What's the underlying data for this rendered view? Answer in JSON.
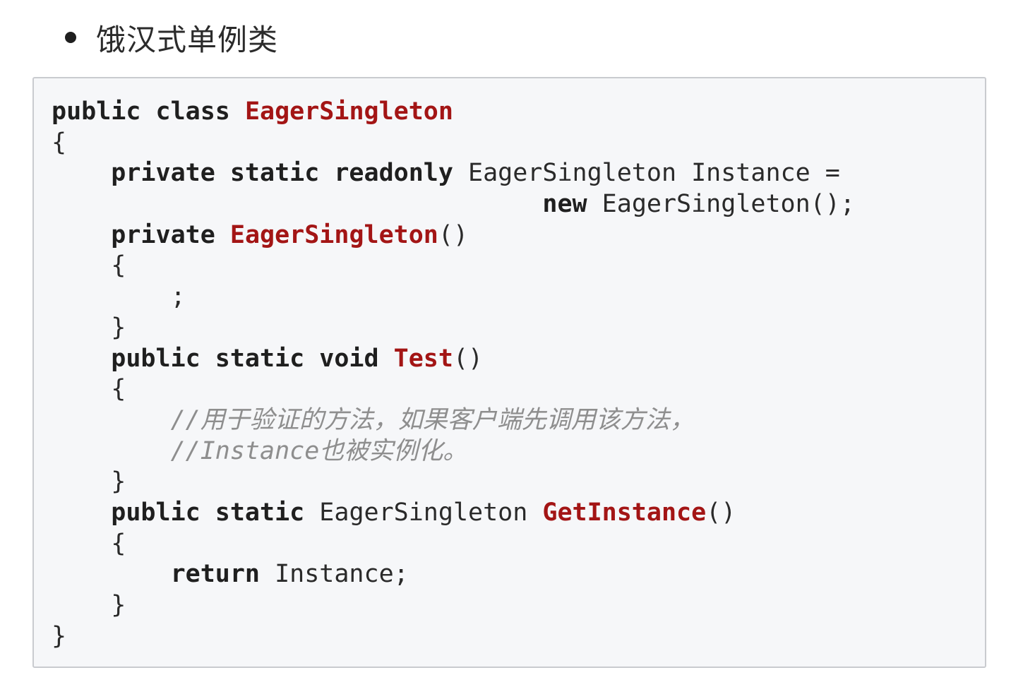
{
  "heading": "饿汉式单例类",
  "code": {
    "lines": [
      [
        {
          "t": "public class ",
          "c": "kw"
        },
        {
          "t": "EagerSingleton",
          "c": "name"
        }
      ],
      [
        {
          "t": "{",
          "c": "txt"
        }
      ],
      [
        {
          "t": "    private static readonly ",
          "c": "kw"
        },
        {
          "t": "EagerSingleton Instance =",
          "c": "txt"
        }
      ],
      [
        {
          "t": "                                 ",
          "c": "txt"
        },
        {
          "t": "new ",
          "c": "kw"
        },
        {
          "t": "EagerSingleton();",
          "c": "txt"
        }
      ],
      [
        {
          "t": "    private ",
          "c": "kw"
        },
        {
          "t": "EagerSingleton",
          "c": "name"
        },
        {
          "t": "()",
          "c": "txt"
        }
      ],
      [
        {
          "t": "    {",
          "c": "txt"
        }
      ],
      [
        {
          "t": "        ;",
          "c": "txt"
        }
      ],
      [
        {
          "t": "    }",
          "c": "txt"
        }
      ],
      [
        {
          "t": "    public static void ",
          "c": "kw"
        },
        {
          "t": "Test",
          "c": "name"
        },
        {
          "t": "()",
          "c": "txt"
        }
      ],
      [
        {
          "t": "    {",
          "c": "txt"
        }
      ],
      [
        {
          "t": "        //用于验证的方法，如果客户端先调用该方法，",
          "c": "cmt"
        }
      ],
      [
        {
          "t": "        //Instance也被实例化。",
          "c": "cmt"
        }
      ],
      [
        {
          "t": "    }",
          "c": "txt"
        }
      ],
      [
        {
          "t": "    public static ",
          "c": "kw"
        },
        {
          "t": "EagerSingleton ",
          "c": "txt"
        },
        {
          "t": "GetInstance",
          "c": "name"
        },
        {
          "t": "()",
          "c": "txt"
        }
      ],
      [
        {
          "t": "    {",
          "c": "txt"
        }
      ],
      [
        {
          "t": "        return ",
          "c": "kw"
        },
        {
          "t": "Instance;",
          "c": "txt"
        }
      ],
      [
        {
          "t": "    }",
          "c": "txt"
        }
      ],
      [
        {
          "t": "}",
          "c": "txt"
        }
      ]
    ]
  }
}
